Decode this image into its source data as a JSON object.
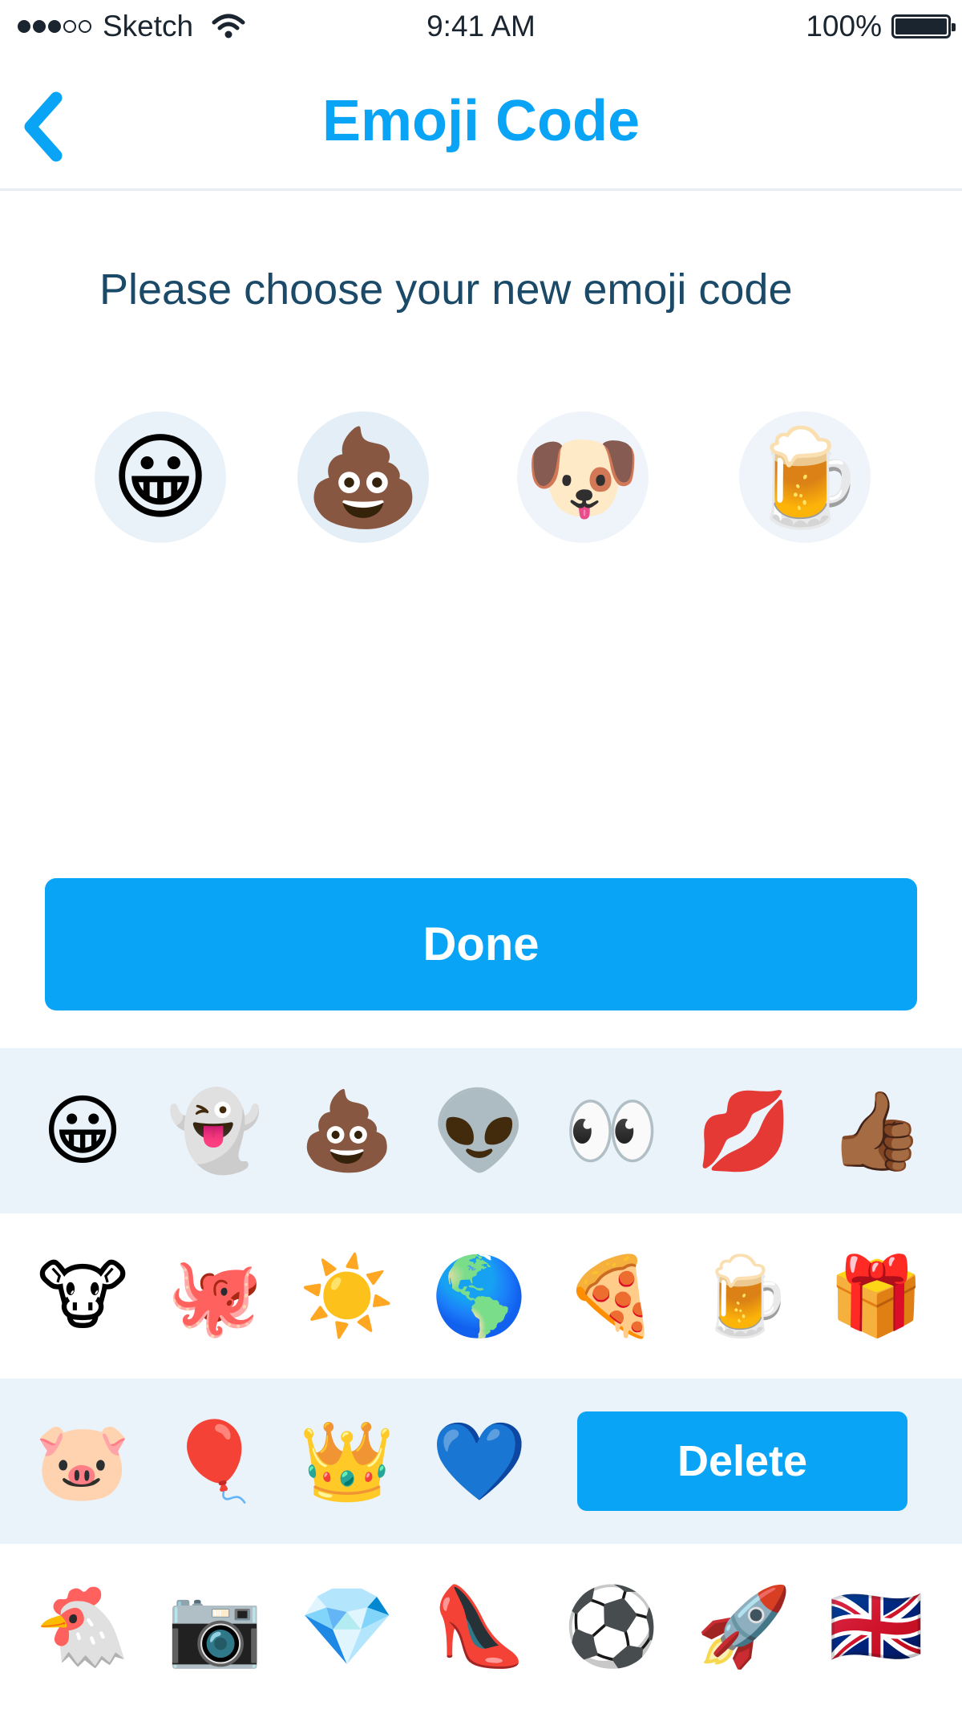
{
  "status_bar": {
    "carrier": "Sketch",
    "time": "9:41 AM",
    "battery": "100%",
    "signal_bars_filled": 3,
    "signal_bars_total": 5
  },
  "nav": {
    "title": "Emoji Code",
    "back_icon": "chevron-left-icon"
  },
  "prompt": "Please choose your new emoji code",
  "selected_code": [
    {
      "emoji": "😀",
      "name": "grinning-face"
    },
    {
      "emoji": "💩",
      "name": "pile-of-poo"
    },
    {
      "emoji": "🐶",
      "name": "dog-face"
    },
    {
      "emoji": "🍺",
      "name": "beer-mug"
    }
  ],
  "done_label": "Done",
  "delete_label": "Delete",
  "keyboard": {
    "row1": [
      "😀",
      "👻",
      "💩",
      "👽",
      "👀",
      "💋",
      "👍🏾"
    ],
    "row2": [
      "🐮",
      "🐙",
      "☀️",
      "🌎",
      "🍕",
      "🍺",
      "🎁"
    ],
    "row3": [
      "🐷",
      "🎈",
      "👑",
      "💙"
    ],
    "row4": [
      "🐔",
      "📷",
      "💎",
      "👠",
      "⚽",
      "🚀",
      "🇬🇧"
    ]
  },
  "colors": {
    "accent": "#0aa4f6",
    "prompt_text": "#1b4968",
    "row_shade": "#ebf3fa"
  }
}
